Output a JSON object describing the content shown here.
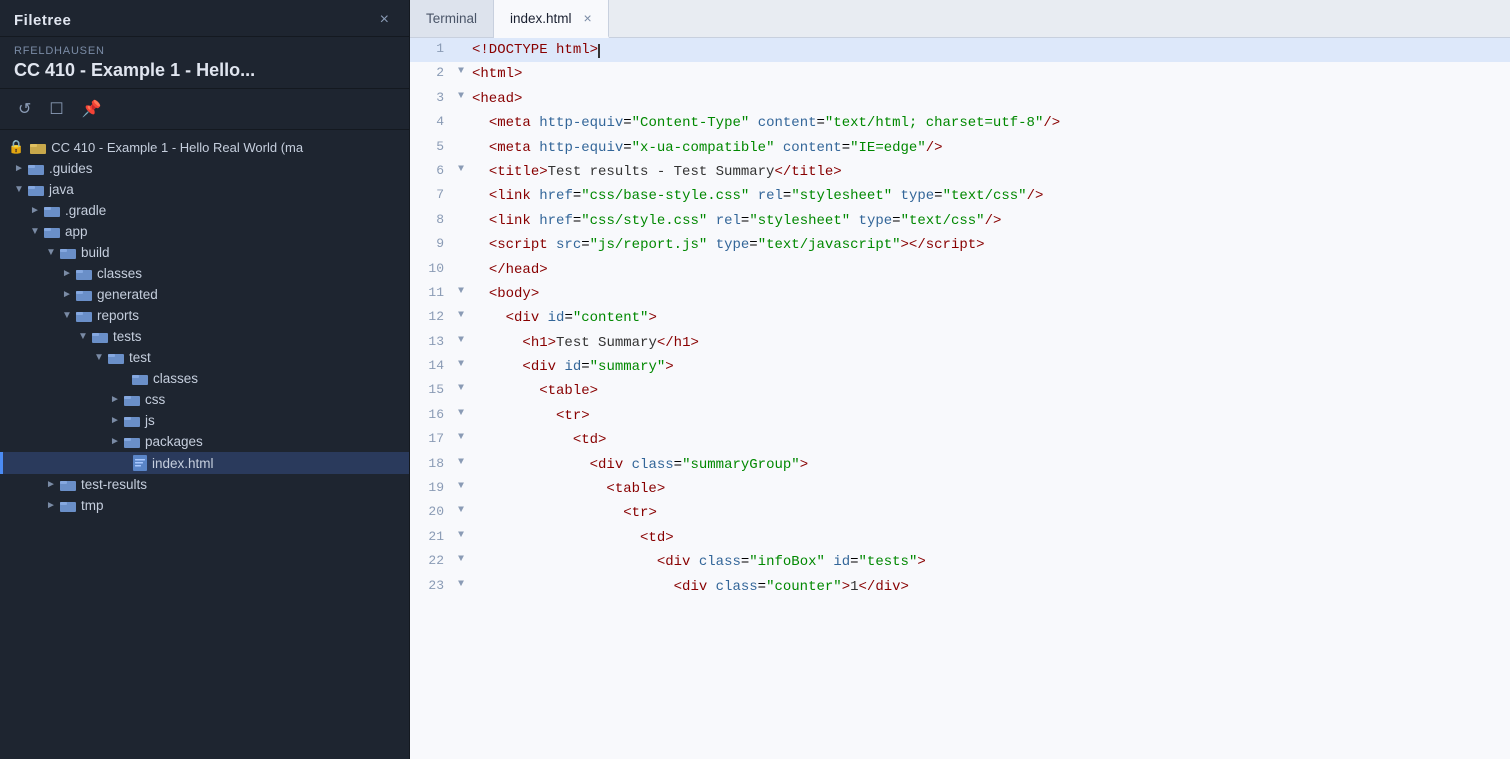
{
  "sidebar": {
    "title": "Filetree",
    "close_label": "×",
    "user": "RFELDHAUSEN",
    "project_name": "CC 410 - Example 1 - Hello...",
    "toolbar_icons": [
      "refresh-icon",
      "monitor-icon",
      "pin-icon"
    ],
    "tree": [
      {
        "id": "root",
        "label": "CC 410 - Example 1 - Hello Real World (ma",
        "type": "root-folder",
        "depth": 0,
        "expanded": true,
        "has_arrow": false,
        "locked": true
      },
      {
        "id": "guides",
        "label": ".guides",
        "type": "folder",
        "depth": 1,
        "expanded": false,
        "has_arrow": true
      },
      {
        "id": "java",
        "label": "java",
        "type": "folder",
        "depth": 1,
        "expanded": true,
        "has_arrow": true
      },
      {
        "id": "gradle",
        "label": ".gradle",
        "type": "folder",
        "depth": 2,
        "expanded": false,
        "has_arrow": true
      },
      {
        "id": "app",
        "label": "app",
        "type": "folder",
        "depth": 2,
        "expanded": true,
        "has_arrow": true
      },
      {
        "id": "build",
        "label": "build",
        "type": "folder",
        "depth": 3,
        "expanded": true,
        "has_arrow": true
      },
      {
        "id": "classes",
        "label": "classes",
        "type": "folder",
        "depth": 4,
        "expanded": false,
        "has_arrow": true
      },
      {
        "id": "generated",
        "label": "generated",
        "type": "folder",
        "depth": 4,
        "expanded": false,
        "has_arrow": true
      },
      {
        "id": "reports",
        "label": "reports",
        "type": "folder",
        "depth": 4,
        "expanded": true,
        "has_arrow": true
      },
      {
        "id": "tests",
        "label": "tests",
        "type": "folder",
        "depth": 5,
        "expanded": true,
        "has_arrow": true
      },
      {
        "id": "test",
        "label": "test",
        "type": "folder",
        "depth": 6,
        "expanded": true,
        "has_arrow": true
      },
      {
        "id": "test-classes",
        "label": "classes",
        "type": "folder",
        "depth": 7,
        "expanded": false,
        "has_arrow": false
      },
      {
        "id": "css",
        "label": "css",
        "type": "folder",
        "depth": 7,
        "expanded": false,
        "has_arrow": true
      },
      {
        "id": "js",
        "label": "js",
        "type": "folder",
        "depth": 7,
        "expanded": false,
        "has_arrow": true
      },
      {
        "id": "packages",
        "label": "packages",
        "type": "folder",
        "depth": 7,
        "expanded": false,
        "has_arrow": true
      },
      {
        "id": "index-html",
        "label": "index.html",
        "type": "file",
        "depth": 7,
        "expanded": false,
        "has_arrow": false,
        "selected": true
      },
      {
        "id": "test-results",
        "label": "test-results",
        "type": "folder",
        "depth": 3,
        "expanded": false,
        "has_arrow": true
      },
      {
        "id": "tmp",
        "label": "tmp",
        "type": "folder",
        "depth": 3,
        "expanded": false,
        "has_arrow": true
      }
    ]
  },
  "tabs": [
    {
      "id": "terminal",
      "label": "Terminal",
      "closeable": false,
      "active": false
    },
    {
      "id": "index-html",
      "label": "index.html",
      "closeable": true,
      "active": true
    }
  ],
  "editor": {
    "lines": [
      {
        "num": 1,
        "fold": false,
        "content_html": "<span class='tag'>&lt;!DOCTYPE html&gt;</span><span class='cursor'></span>",
        "highlighted": true
      },
      {
        "num": 2,
        "fold": true,
        "content_html": "<span class='tag'>&lt;html&gt;</span>"
      },
      {
        "num": 3,
        "fold": true,
        "content_html": "<span class='tag'>&lt;head&gt;</span>"
      },
      {
        "num": 4,
        "fold": false,
        "content_html": "  <span class='tag'>&lt;meta </span><span class='attr-name'>http-equiv</span>=<span class='attr-value'>\"Content-Type\"</span><span class='tag'> </span><span class='attr-name'>content</span>=<span class='attr-value'>\"text/html; charset=utf-8\"</span><span class='tag'>/&gt;</span>"
      },
      {
        "num": 5,
        "fold": false,
        "content_html": "  <span class='tag'>&lt;meta </span><span class='attr-name'>http-equiv</span>=<span class='attr-value'>\"x-ua-compatible\"</span><span class='tag'> </span><span class='attr-name'>content</span>=<span class='attr-value'>\"IE=edge\"</span><span class='tag'>/&gt;</span>"
      },
      {
        "num": 6,
        "fold": true,
        "content_html": "  <span class='tag'>&lt;title&gt;</span><span class='text-content'>Test results - Test Summary</span><span class='tag'>&lt;/title&gt;</span>"
      },
      {
        "num": 7,
        "fold": false,
        "content_html": "  <span class='tag'>&lt;link </span><span class='attr-name'>href</span>=<span class='attr-value'>\"css/base-style.css\"</span><span class='tag'> </span><span class='attr-name'>rel</span>=<span class='attr-value'>\"stylesheet\"</span><span class='tag'> </span><span class='attr-name'>type</span>=<span class='attr-value'>\"text/css\"</span><span class='tag'>/&gt;</span>"
      },
      {
        "num": 8,
        "fold": false,
        "content_html": "  <span class='tag'>&lt;link </span><span class='attr-name'>href</span>=<span class='attr-value'>\"css/style.css\"</span><span class='tag'> </span><span class='attr-name'>rel</span>=<span class='attr-value'>\"stylesheet\"</span><span class='tag'> </span><span class='attr-name'>type</span>=<span class='attr-value'>\"text/css\"</span><span class='tag'>/&gt;</span>"
      },
      {
        "num": 9,
        "fold": false,
        "content_html": "  <span class='tag'>&lt;script </span><span class='attr-name'>src</span>=<span class='attr-value'>\"js/report.js\"</span><span class='tag'> </span><span class='attr-name'>type</span>=<span class='attr-value'>\"text/javascript\"</span><span class='tag'>&gt;&lt;/script&gt;</span>"
      },
      {
        "num": 10,
        "fold": false,
        "content_html": "  <span class='tag'>&lt;/head&gt;</span>"
      },
      {
        "num": 11,
        "fold": true,
        "content_html": "  <span class='tag'>&lt;body&gt;</span>"
      },
      {
        "num": 12,
        "fold": true,
        "content_html": "    <span class='tag'>&lt;div </span><span class='attr-name'>id</span>=<span class='attr-value'>\"content\"</span><span class='tag'>&gt;</span>"
      },
      {
        "num": 13,
        "fold": true,
        "content_html": "      <span class='tag'>&lt;h1&gt;</span><span class='text-content'>Test Summary</span><span class='tag'>&lt;/h1&gt;</span>"
      },
      {
        "num": 14,
        "fold": true,
        "content_html": "      <span class='tag'>&lt;div </span><span class='attr-name'>id</span>=<span class='attr-value'>\"summary\"</span><span class='tag'>&gt;</span>"
      },
      {
        "num": 15,
        "fold": true,
        "content_html": "        <span class='tag'>&lt;table&gt;</span>"
      },
      {
        "num": 16,
        "fold": true,
        "content_html": "          <span class='tag'>&lt;tr&gt;</span>"
      },
      {
        "num": 17,
        "fold": true,
        "content_html": "            <span class='tag'>&lt;td&gt;</span>"
      },
      {
        "num": 18,
        "fold": true,
        "content_html": "              <span class='tag'>&lt;div </span><span class='attr-name'>class</span>=<span class='attr-value'>\"summaryGroup\"</span><span class='tag'>&gt;</span>"
      },
      {
        "num": 19,
        "fold": true,
        "content_html": "                <span class='tag'>&lt;table&gt;</span>"
      },
      {
        "num": 20,
        "fold": true,
        "content_html": "                  <span class='tag'>&lt;tr&gt;</span>"
      },
      {
        "num": 21,
        "fold": true,
        "content_html": "                    <span class='tag'>&lt;td&gt;</span>"
      },
      {
        "num": 22,
        "fold": true,
        "content_html": "                      <span class='tag'>&lt;div </span><span class='attr-name'>class</span>=<span class='attr-value'>\"infoBox\"</span><span class='tag'> </span><span class='attr-name'>id</span>=<span class='attr-value'>\"tests\"</span><span class='tag'>&gt;</span>"
      },
      {
        "num": 23,
        "fold": true,
        "content_html": "                        <span class='tag'>&lt;div </span><span class='attr-name'>class</span>=<span class='attr-value'>\"counter\"</span><span class='tag'>&gt;</span><span class='text-content'>1</span><span class='tag'>&lt;/div&gt;</span>"
      }
    ]
  }
}
